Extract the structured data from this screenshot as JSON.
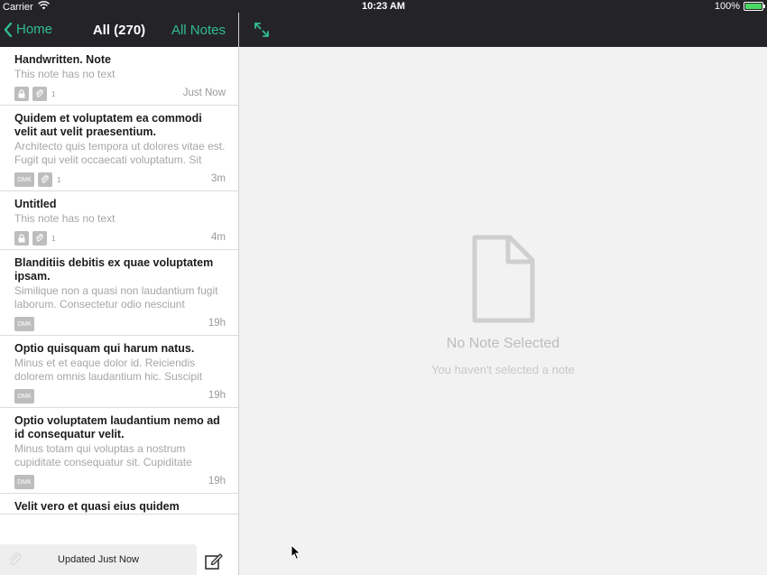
{
  "status_bar": {
    "carrier": "Carrier",
    "time": "10:23 AM",
    "battery": "100%"
  },
  "nav": {
    "back_label": "Home",
    "title": "All (270)",
    "right_label": "All Notes"
  },
  "notes": [
    {
      "title": "Handwritten. Note",
      "preview": "This note has no text",
      "time": "Just Now",
      "lock": true,
      "dmk": false,
      "attachments": "1"
    },
    {
      "title": "Quidem et voluptatem ea commodi velit aut velit praesentium.",
      "preview": "Architecto quis tempora ut dolores vitae est. Fugit qui velit occaecati voluptatum. Sit",
      "time": "3m",
      "lock": false,
      "dmk": true,
      "attachments": "1"
    },
    {
      "title": "Untitled",
      "preview": "This note has no text",
      "time": "4m",
      "lock": true,
      "dmk": false,
      "attachments": "1"
    },
    {
      "title": "Blanditiis debitis ex quae voluptatem ipsam.",
      "preview": "Similique non a quasi non laudantium fugit laborum. Consectetur odio nesciunt",
      "time": "19h",
      "lock": false,
      "dmk": true,
      "attachments": ""
    },
    {
      "title": "Optio quisquam qui harum natus.",
      "preview": "Minus et et eaque dolor id. Reiciendis dolorem omnis laudantium hic. Suscipit",
      "time": "19h",
      "lock": false,
      "dmk": true,
      "attachments": ""
    },
    {
      "title": "Optio voluptatem laudantium nemo ad id consequatur velit.",
      "preview": "Minus totam qui voluptas a nostrum cupiditate consequatur sit. Cupiditate",
      "time": "19h",
      "lock": false,
      "dmk": true,
      "attachments": ""
    },
    {
      "title": "Velit vero et quasi eius quidem",
      "preview": "",
      "time": "",
      "lock": false,
      "dmk": false,
      "attachments": ""
    }
  ],
  "dmk_label": "DMK",
  "bottom": {
    "update_status": "Updated Just Now"
  },
  "empty_state": {
    "title": "No Note Selected",
    "subtitle": "You haven't selected a note"
  },
  "colors": {
    "accent": "#2fbe8d",
    "nav_bg": "#242428"
  },
  "icons": [
    "wifi-icon",
    "battery-icon",
    "chevron-left-icon",
    "expand-icon",
    "lock-icon",
    "paperclip-icon",
    "compose-icon",
    "document-icon",
    "pointer-cursor-icon"
  ]
}
